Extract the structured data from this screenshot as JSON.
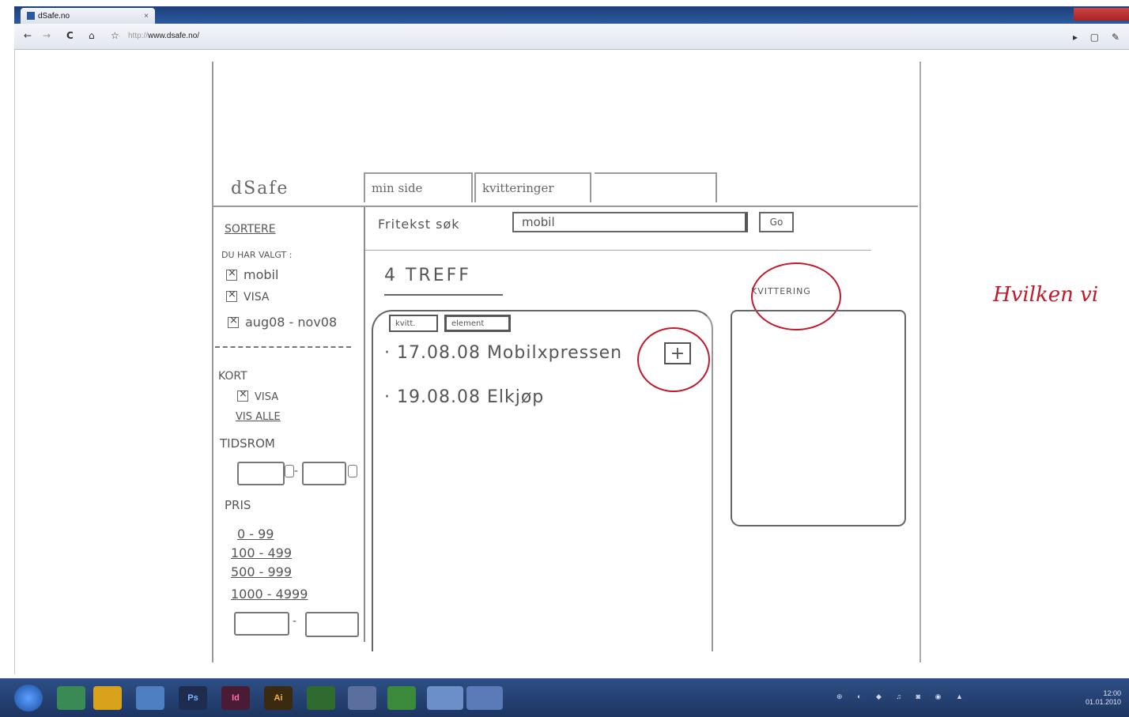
{
  "browser": {
    "tab_title": "dSafe.no",
    "tab_close": "×",
    "back": "←",
    "forward": "→",
    "reload": "C",
    "home": "⌂",
    "star": "☆",
    "url_scheme": "http://",
    "url_host": "www.dsafe.no/",
    "right_tools": "▸ ▢ ✎"
  },
  "sketch": {
    "logo": "dSafe",
    "tabs": [
      "min side",
      "kvitteringer",
      ""
    ],
    "sidebar": {
      "sort_title": "SORTERE",
      "selected_title": "DU HAR VALGT :",
      "selected": [
        "mobil",
        "VISA",
        "aug08 - nov08"
      ],
      "card_title": "KORT",
      "card_option": "VISA",
      "show_all": "VIS ALLE",
      "period_title": "TIDSROM",
      "price_title": "PRIS",
      "price_ranges": [
        "0 - 99",
        "100 - 499",
        "500 - 999",
        "1000 - 4999"
      ],
      "range_sep": "-"
    },
    "search": {
      "label": "Fritekst søk",
      "value": "mobil",
      "go": "Go"
    },
    "hits": "4 TREFF",
    "result_tabs": [
      "kvitt.",
      "element"
    ],
    "results": [
      "· 17.08.08 Mobilxpressen",
      "· 19.08.08 Elkjøp"
    ],
    "plus": "+",
    "receipt_label": "KVITTERING",
    "note": "Hvilken vi"
  },
  "taskbar": {
    "apps": [
      "",
      "",
      "",
      "",
      "Ps",
      "Id",
      "Ai",
      "",
      "",
      "",
      "",
      ""
    ],
    "tray": "⊕ ◐ ◆ ♫ ◙ ◉ ▲",
    "time": "12:00",
    "date": "01.01.2010"
  },
  "colors": {
    "annotation": "#c11a2a",
    "pencil": "#555555",
    "taskbar": "#2e4f86"
  }
}
